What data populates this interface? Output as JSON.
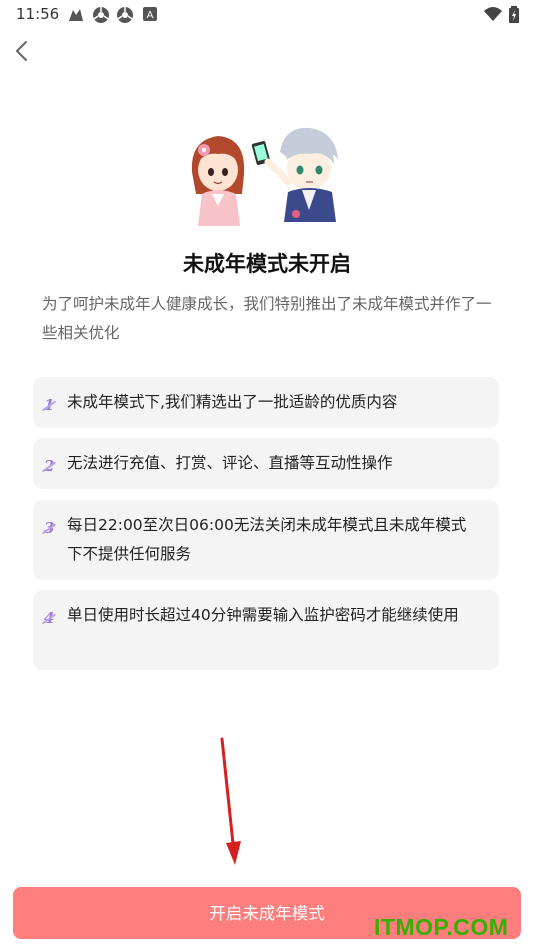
{
  "status_bar": {
    "time": "11:56",
    "icons": [
      "app-notification-icon",
      "chrome-icon",
      "chrome-icon",
      "a-box-icon",
      "wifi-icon",
      "battery-icon"
    ]
  },
  "nav": {
    "back_icon": "chevron-left-icon"
  },
  "illustration": {
    "name": "couple-characters-illustration"
  },
  "title": "未成年模式未开启",
  "subtitle": "为了呵护未成年人健康成长，我们特别推出了未成年模式并作了一些相关优化",
  "features": [
    {
      "num": "1",
      "text": "未成年模式下,我们精选出了一批适龄的优质内容"
    },
    {
      "num": "2",
      "text": "无法进行充值、打赏、评论、直播等互动性操作"
    },
    {
      "num": "3",
      "text": "每日22:00至次日06:00无法关闭未成年模式且未成年模式下不提供任何服务"
    },
    {
      "num": "4",
      "text": "单日使用时长超过40分钟需要输入监护密码才能继续使用"
    }
  ],
  "button": {
    "label": "开启未成年模式"
  },
  "watermark": "ITMOP.COM",
  "colors": {
    "button": "#fe7d7d",
    "accent": "#9a7ed8",
    "card_bg": "#f4f4f4",
    "arrow": "#d42020"
  }
}
